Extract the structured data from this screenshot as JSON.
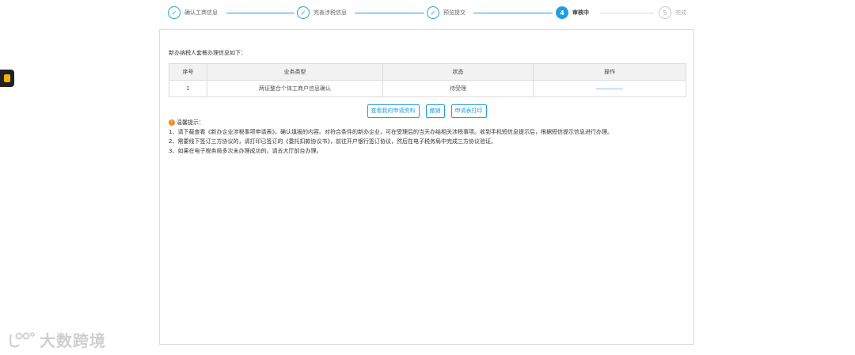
{
  "steps": [
    {
      "num": "✓",
      "label": "确认工商信息",
      "state": "done"
    },
    {
      "num": "✓",
      "label": "完善涉税信息",
      "state": "done"
    },
    {
      "num": "✓",
      "label": "预览提交",
      "state": "done"
    },
    {
      "num": "4",
      "label": "审核中",
      "state": "active"
    },
    {
      "num": "5",
      "label": "完成",
      "state": "pending"
    }
  ],
  "panel": {
    "intro": "新办纳税人套餐办理信息如下：",
    "table": {
      "headers": [
        "序号",
        "业务类型",
        "状态",
        "操作"
      ],
      "rows": [
        {
          "index": "1",
          "type": "两证整合个体工商户信息确认",
          "status": "待受理"
        }
      ]
    },
    "buttons": {
      "view_materials": "查看我的申请资料",
      "revoke": "撤销",
      "print_form": "申请表打印"
    },
    "tips": {
      "title": "温馨提示：",
      "lines": [
        "1、请下载查看《新办企业涉税事项申请表》，确认填报的内容。对符合条件的新办企业，可在受理后的当天办结相关涉税事项。收到手机短信息提示后，根据短信提示信息进行办理。",
        "2、需要线下签订三方协议的，请打印已签订的《委托扣款协议书》，前往开户银行签订协议，然后在电子税务局中完成三方协议验证。",
        "3、如果在电子税务局多次未办理成功的，请去大厅前台办理。"
      ]
    }
  },
  "watermark": {
    "text": "大数跨境"
  },
  "colors": {
    "accent": "#1e9fe0",
    "tip": "#f08a24"
  }
}
